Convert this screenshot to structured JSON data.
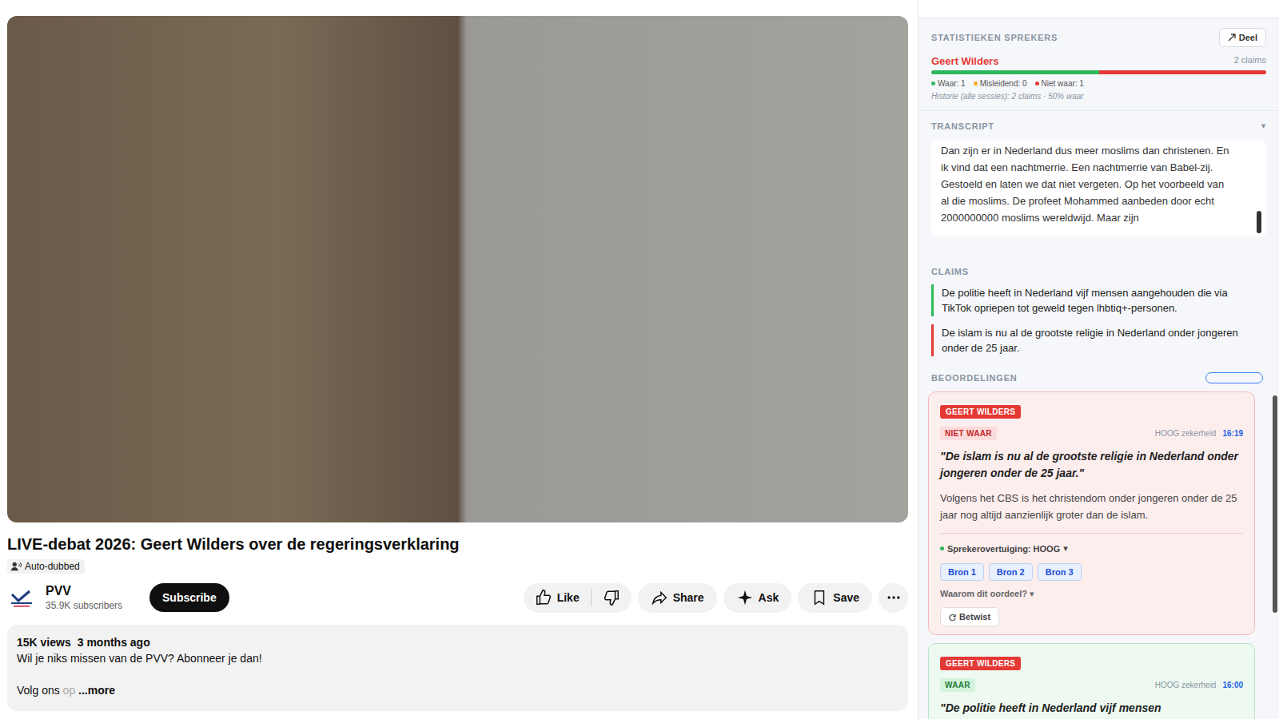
{
  "video": {
    "title": "LIVE-debat 2026: Geert Wilders over de regeringsverklaring",
    "dub_label": "Auto-dubbed"
  },
  "channel": {
    "name": "PVV",
    "subscribers": "35.9K subscribers",
    "subscribe": "Subscribe"
  },
  "like": {
    "label": "Like"
  },
  "buttons": [
    {
      "label": "Share",
      "kind": "share"
    },
    {
      "label": "Ask",
      "kind": "ask"
    },
    {
      "label": "Save",
      "kind": "save"
    }
  ],
  "description": {
    "views": "15K views",
    "age": "3 months ago",
    "text": "Wil je niks missen van de PVV? Abonneer je dan!",
    "follow": "Volg ons",
    "follow_fade": "op",
    "more": "...more"
  },
  "factchecker": {
    "stats": {
      "title": "STATISTIEKEN SPREKERS",
      "share": "Deel",
      "speakers": [
        {
          "name": "Geert Wilders",
          "claims": "2 claims",
          "color": "#e53935",
          "segments": [
            {
              "level": 0.5,
              "color": "#2eb85c"
            },
            {
              "level": 0.5,
              "color": "#e53935"
            }
          ],
          "legend": [
            {
              "label": "Waar: 1",
              "color": "#2eb85c"
            },
            {
              "label": "Misleidend: 0",
              "color": "#f5a623"
            },
            {
              "label": "Niet waar: 1",
              "color": "#e53935"
            }
          ],
          "history": "Historie (alle sessies): 2 claims · 50% waar"
        }
      ]
    },
    "transcript": {
      "title": "TRANSCRIPT",
      "caret": "▾",
      "lines": [
        "Dan zijn er in Nederland dus meer moslims dan christenen. En",
        "ik vind dat een nachtmerrie. Een nachtmerrie van Babel-zij.",
        "Gestoeld en laten we dat niet vergeten. Op het voorbeeld van",
        "al die moslims. De profeet Mohammed aanbeden door echt",
        "2000000000 moslims wereldwijd. Maar zijn"
      ]
    },
    "claims": {
      "title": "CLAIMS",
      "items": [
        {
          "text": "De politie heeft in Nederland vijf mensen aangehouden die via TikTok opriepen tot geweld tegen lhbtiq+-personen.",
          "color": "#2eb85c"
        },
        {
          "text": "De islam is nu al de grootste religie in Nederland onder jongeren onder de 25 jaar.",
          "color": "#e53935"
        }
      ]
    },
    "ratings": {
      "title": "BEOORDELINGEN",
      "cards": [
        {
          "kind": "false",
          "speaker": "GEERT WILDERS",
          "verdict": "NIET WAAR",
          "certainty": "HOOG zekerheid",
          "time": "16:19",
          "quote": "\"De islam is nu al de grootste religie in Nederland onder jongeren onder de 25 jaar.\"",
          "explanation": "Volgens het CBS is het christendom onder jongeren onder de 25 jaar nog altijd aanzienlijk groter dan de islam.",
          "conviction": "Sprekerovertuiging: HOOG",
          "conviction_caret": "▾",
          "sources": [
            "Bron 1",
            "Bron 2",
            "Bron 3"
          ],
          "why": "Waarom dit oordeel? ▾",
          "dispute": "Betwist"
        },
        {
          "kind": "true",
          "speaker": "GEERT WILDERS",
          "verdict": "WAAR",
          "certainty": "HOOG zekerheid",
          "time": "16:00",
          "quote": "\"De politie heeft in Nederland vijf mensen"
        }
      ]
    }
  }
}
